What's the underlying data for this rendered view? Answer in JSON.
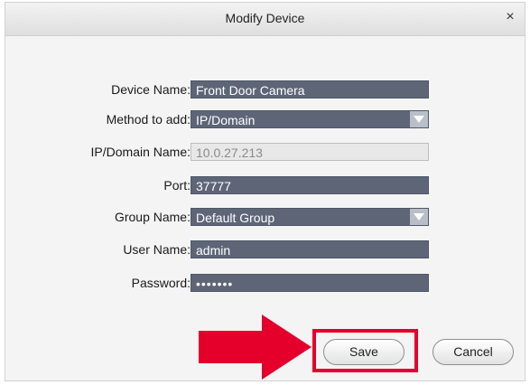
{
  "dialog": {
    "title": "Modify Device",
    "close_glyph": "×"
  },
  "form": {
    "device_name": {
      "label": "Device Name:",
      "value": "Front Door Camera"
    },
    "method": {
      "label": "Method to add:",
      "value": "IP/Domain"
    },
    "ip_domain": {
      "label": "IP/Domain Name:",
      "value": "10.0.27.213"
    },
    "port": {
      "label": "Port:",
      "value": "37777"
    },
    "group": {
      "label": "Group Name:",
      "value": "Default Group"
    },
    "username": {
      "label": "User Name:",
      "value": "admin"
    },
    "password": {
      "label": "Password:",
      "value": "•••••••"
    }
  },
  "buttons": {
    "save": "Save",
    "cancel": "Cancel"
  },
  "colors": {
    "field_bg": "#5d6577",
    "highlight": "#e4002b",
    "arrow": "#e4002b"
  },
  "icons": {
    "close": "close-icon",
    "dropdown": "chevron-down-icon",
    "pointer": "red-arrow-icon"
  }
}
